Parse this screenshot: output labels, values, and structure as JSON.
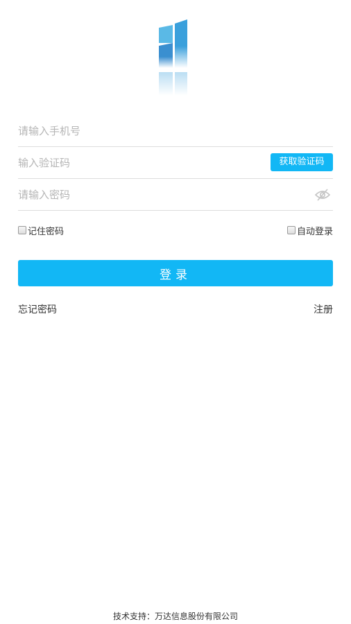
{
  "logo": {
    "icon": "building-logo-icon",
    "colors": [
      "#3aa0dc",
      "#5ab9e6"
    ]
  },
  "form": {
    "phone_placeholder": "请输入手机号",
    "code_placeholder": "输入验证码",
    "sms_button_label": "获取验证码",
    "password_placeholder": "请输入密码",
    "eye_icon": "hide-password-eye-icon"
  },
  "options": {
    "remember_label": "记住密码",
    "auto_login_label": "自动登录"
  },
  "login_button_label": "登录",
  "links": {
    "forgot_label": "忘记密码",
    "register_label": "注册"
  },
  "footer": {
    "text": "技术支持：万达信息股份有限公司"
  },
  "colors": {
    "accent": "#12b7f5",
    "divider": "#dcdcdc",
    "placeholder": "#b5b5b5"
  }
}
